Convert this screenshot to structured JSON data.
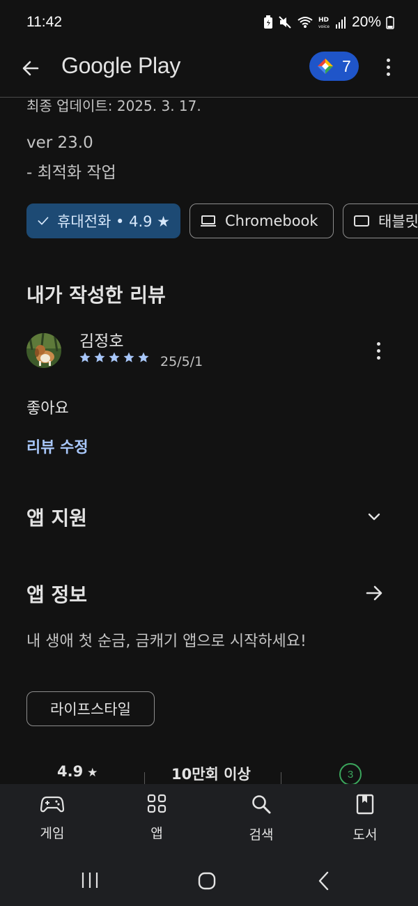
{
  "status_bar": {
    "time": "11:42",
    "battery": "20%"
  },
  "app_bar": {
    "title": "Google Play",
    "points": "7"
  },
  "update": {
    "last_updated": "최종 업데이트: 2025. 3. 17.",
    "version": "ver 23.0",
    "note": "- 최적화 작업"
  },
  "device_chips": [
    {
      "label": "휴대전화 • 4.9 ★",
      "selected": true,
      "icon": "check-icon"
    },
    {
      "label": "Chromebook",
      "selected": false,
      "icon": "laptop-icon"
    },
    {
      "label": "태블릿",
      "selected": false,
      "icon": "tablet-icon"
    }
  ],
  "my_review": {
    "heading": "내가 작성한 리뷰",
    "reviewer": "김정호",
    "rating": 5,
    "date": "25/5/1",
    "text": "좋아요",
    "edit_label": "리뷰 수정"
  },
  "app_support": {
    "heading": "앱 지원"
  },
  "app_info": {
    "heading": "앱 정보",
    "description": "내 생애 첫 순금, 금캐기 앱으로 시작하세요!",
    "category": "라이프스타일"
  },
  "stats": {
    "rating": "4.9",
    "downloads": "10만회 이상",
    "age_rating": "3"
  },
  "bottom_nav": [
    {
      "label": "게임",
      "icon": "gamepad-icon"
    },
    {
      "label": "앱",
      "icon": "apps-grid-icon"
    },
    {
      "label": "검색",
      "icon": "search-icon"
    },
    {
      "label": "도서",
      "icon": "book-icon"
    }
  ],
  "colors": {
    "background": "#121212",
    "selected_chip": "#1d4a74",
    "link": "#a8c7fa",
    "points_badge": "#1f55c9",
    "star": "#a8c7fa"
  }
}
